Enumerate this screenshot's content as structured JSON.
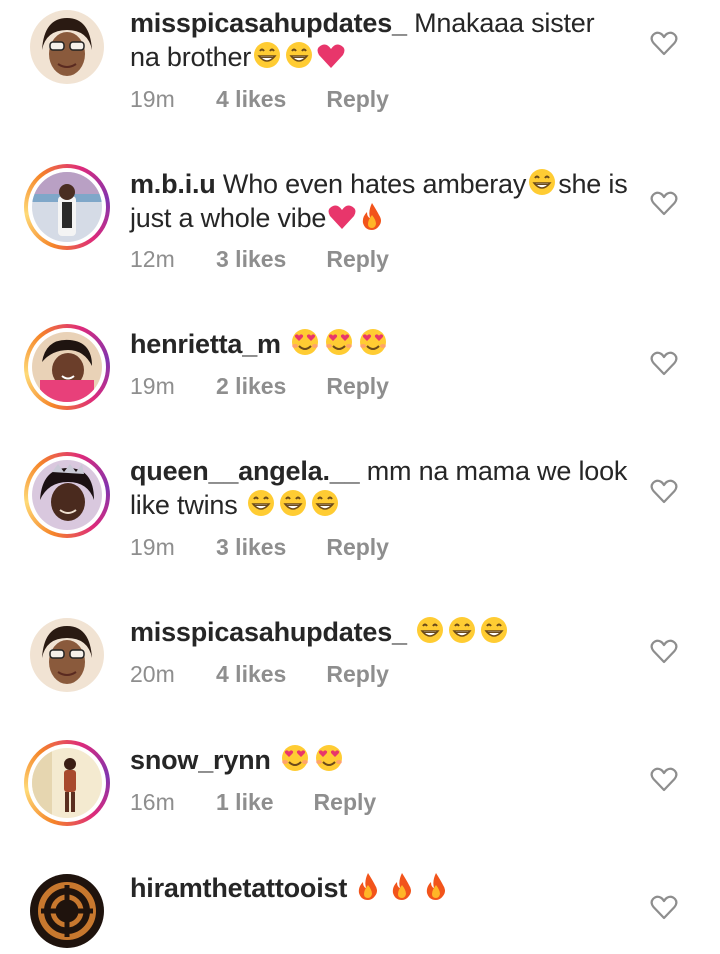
{
  "comments": [
    {
      "username": "misspicasahupdates_",
      "text": " Mnakaaa sister na brother",
      "emojis": [
        "grin",
        "grin",
        "heart"
      ],
      "time": "19m",
      "likes": "4 likes",
      "reply": "Reply",
      "story_ring": false,
      "avatar_colors": [
        "#e8c9a0",
        "#3b2516"
      ]
    },
    {
      "username": "m.b.i.u",
      "text": " Who even hates amberay",
      "text2": "she is just a whole vibe",
      "emojis_mid": [
        "grin"
      ],
      "emojis": [
        "heart",
        "fire"
      ],
      "time": "12m",
      "likes": "3 likes",
      "reply": "Reply",
      "story_ring": true,
      "avatar_colors": [
        "#b7c4d6",
        "#2a2a2a"
      ]
    },
    {
      "username": "henrietta_m",
      "text": " ",
      "emojis": [
        "hearteyes",
        "hearteyes",
        "hearteyes"
      ],
      "time": "19m",
      "likes": "2 likes",
      "reply": "Reply",
      "story_ring": true,
      "avatar_colors": [
        "#d9b48a",
        "#e8407a"
      ]
    },
    {
      "username": "queen__angela.__",
      "text": " mm na mama we look like twins ",
      "emojis": [
        "grin",
        "grin",
        "grin"
      ],
      "time": "19m",
      "likes": "3 likes",
      "reply": "Reply",
      "story_ring": true,
      "avatar_colors": [
        "#c6b2d8",
        "#3a2530"
      ]
    },
    {
      "username": "misspicasahupdates_",
      "text": " ",
      "emojis": [
        "grin",
        "grin",
        "grin"
      ],
      "time": "20m",
      "likes": "4 likes",
      "reply": "Reply",
      "story_ring": false,
      "avatar_colors": [
        "#e8c9a0",
        "#3b2516"
      ]
    },
    {
      "username": "snow_rynn",
      "text": " ",
      "emojis": [
        "hearteyes",
        "hearteyes"
      ],
      "time": "16m",
      "likes": "1 like",
      "reply": "Reply",
      "story_ring": true,
      "avatar_colors": [
        "#f3e8c8",
        "#7a3b2a"
      ]
    },
    {
      "username": "hiramthetattooist",
      "text": " ",
      "emojis": [
        "fire",
        "fire",
        "fire"
      ],
      "time": "",
      "likes": "",
      "reply": "",
      "story_ring": false,
      "avatar_colors": [
        "#2b1a12",
        "#c8782e"
      ]
    }
  ],
  "colors": {
    "text": "#262626",
    "meta": "#8e8e8e",
    "heart_outline": "#8e8e8e",
    "emoji_heart": "#e8366b"
  }
}
